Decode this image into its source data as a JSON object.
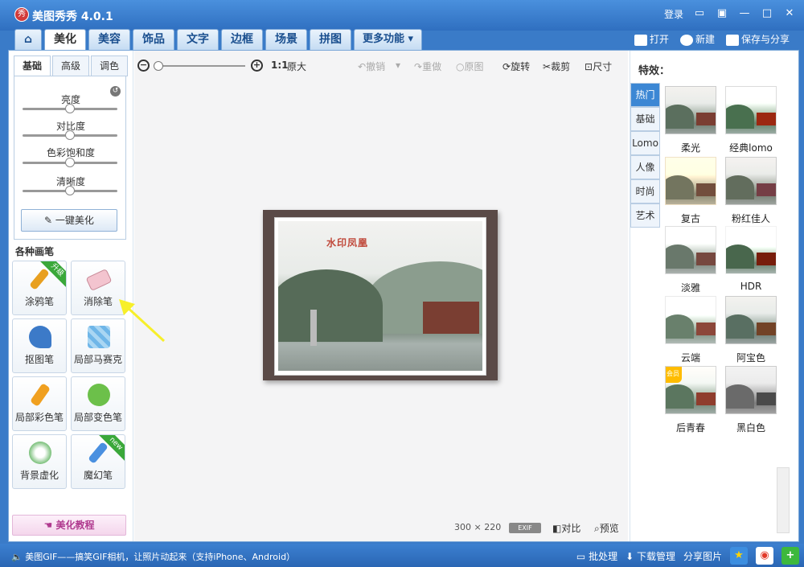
{
  "app": {
    "title": "美图秀秀 4.0.1",
    "logo": "秀"
  },
  "titlebar": {
    "login": "登录"
  },
  "tabs": [
    {
      "label": "美化",
      "active": true
    },
    {
      "label": "美容"
    },
    {
      "label": "饰品"
    },
    {
      "label": "文字"
    },
    {
      "label": "边框"
    },
    {
      "label": "场景"
    },
    {
      "label": "拼图"
    },
    {
      "label": "更多功能 ▾"
    }
  ],
  "top_actions": {
    "open": "打开",
    "new": "新建",
    "save": "保存与分享"
  },
  "left": {
    "subtabs": [
      "基础",
      "高级",
      "调色"
    ],
    "sliders": [
      {
        "label": "亮度",
        "level": 0.5
      },
      {
        "label": "对比度",
        "level": 0.5
      },
      {
        "label": "色彩饱和度",
        "level": 0.5
      },
      {
        "label": "清晰度",
        "level": 0.5
      }
    ],
    "one_key": "一键美化",
    "brushes_title": "各种画笔",
    "brushes": [
      {
        "label": "涂鸦笔",
        "badge": "升级",
        "color": "#e8a020"
      },
      {
        "label": "消除笔",
        "color": "#e8a0b0"
      },
      {
        "label": "抠图笔",
        "color": "#3c7ac8"
      },
      {
        "label": "局部马赛克",
        "color": "#6fb6e8"
      },
      {
        "label": "局部彩色笔",
        "color": "#f0a020"
      },
      {
        "label": "局部变色笔",
        "color": "#6cc04a"
      },
      {
        "label": "背景虚化",
        "color": "#7ac07a"
      },
      {
        "label": "魔幻笔",
        "badge": "new",
        "color": "#4a90e0"
      }
    ],
    "tutorial": "美化教程"
  },
  "canvas": {
    "zoom_ratio": "1:1",
    "original_size": "原大",
    "undo": "撤销",
    "redo": "重做",
    "original": "原图",
    "rotate": "旋转",
    "crop": "裁剪",
    "resize": "尺寸",
    "watermark": "水印凤凰",
    "width": "300",
    "times": "×",
    "height": "220",
    "exif": "EXIF",
    "compare": "对比",
    "preview": "预览"
  },
  "effects": {
    "title": "特效：",
    "categories": [
      "热门",
      "基础",
      "Lomo",
      "人像",
      "时尚",
      "艺术"
    ],
    "items": [
      {
        "label": "柔光"
      },
      {
        "label": "经典lomo"
      },
      {
        "label": "复古"
      },
      {
        "label": "粉红佳人"
      },
      {
        "label": "淡雅"
      },
      {
        "label": "HDR"
      },
      {
        "label": "云端"
      },
      {
        "label": "阿宝色"
      },
      {
        "label": "后青春",
        "badge": "会员"
      },
      {
        "label": "黑白色"
      }
    ]
  },
  "statusbar": {
    "message": "美图GIF——搞笑GIF相机，让照片动起来（支持iPhone、Android）",
    "batch": "批处理",
    "download": "下载管理",
    "share": "分享图片"
  },
  "colors": {
    "accent": "#3c87d4",
    "titlebar": "#2f6fc0",
    "frame": "#5a4a47"
  }
}
